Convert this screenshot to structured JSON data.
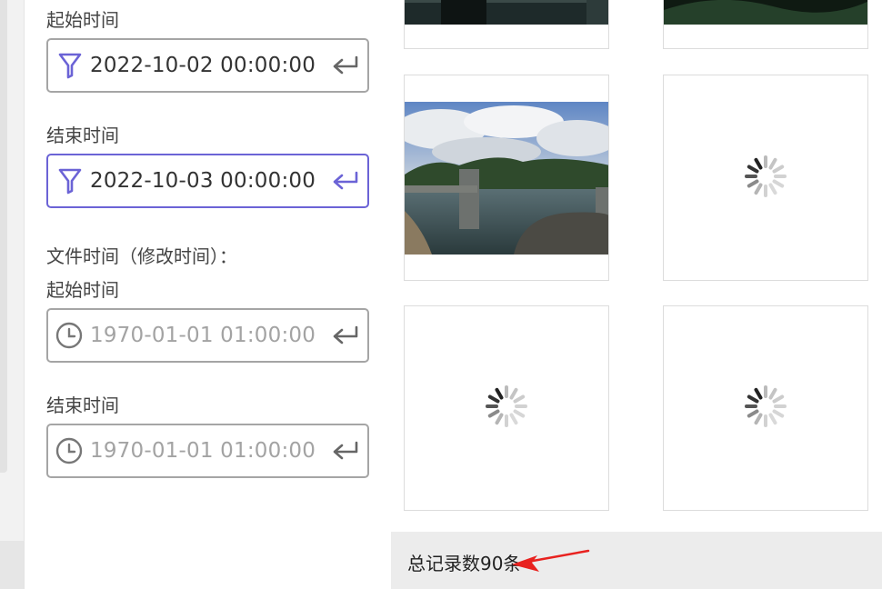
{
  "filters": {
    "create_start_label": "起始时间",
    "create_start_value": "2022-10-02 00:00:00",
    "create_end_label": "结束时间",
    "create_end_value": "2022-10-03 00:00:00",
    "file_time_heading": "文件时间（修改时间）：",
    "file_start_label": "起始时间",
    "file_start_value": "1970-01-01 01:00:00",
    "file_end_label": "结束时间",
    "file_end_value": "1970-01-01 01:00:00"
  },
  "icons": {
    "filter": "filter-icon",
    "clock": "clock-icon",
    "enter": "enter-icon",
    "spinner": "loading-spinner-icon"
  },
  "colors": {
    "accent": "#6b63d6",
    "arrow": "#e8221f"
  },
  "footer": {
    "total": "总记录数90条"
  }
}
